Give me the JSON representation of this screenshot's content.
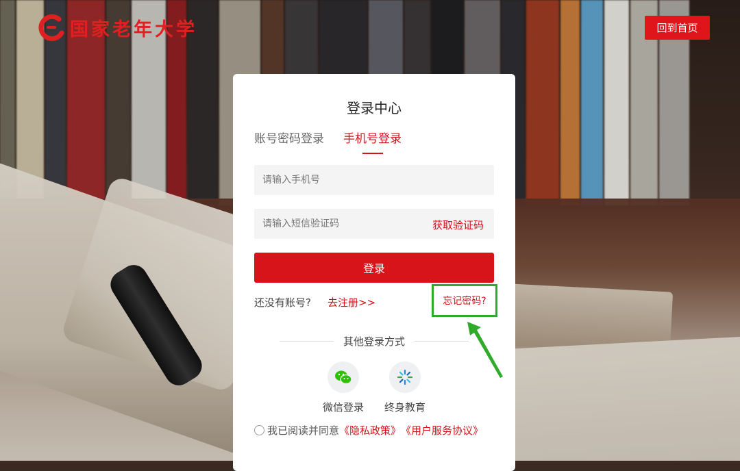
{
  "header": {
    "logo_text": "国家老年大学",
    "home_button": "回到首页"
  },
  "login": {
    "title": "登录中心",
    "tabs": [
      {
        "label": "账号密码登录",
        "active": false
      },
      {
        "label": "手机号登录",
        "active": true
      }
    ],
    "phone_placeholder": "请输入手机号",
    "sms_placeholder": "请输入短信验证码",
    "get_code": "获取验证码",
    "submit": "登录",
    "no_account": "还没有账号?",
    "register": "去注册>>",
    "forgot": "忘记密码?",
    "other_methods": "其他登录方式",
    "social": [
      {
        "label": "微信登录",
        "icon": "wechat-icon"
      },
      {
        "label": "终身教育",
        "icon": "lifelong-education-icon"
      }
    ],
    "agreement": {
      "prefix": "我已阅读并同意",
      "privacy": "《隐私政策》",
      "terms": "《用户服务协议》"
    }
  },
  "colors": {
    "brand_red": "#d4121a",
    "highlight_green": "#2faa2a"
  }
}
